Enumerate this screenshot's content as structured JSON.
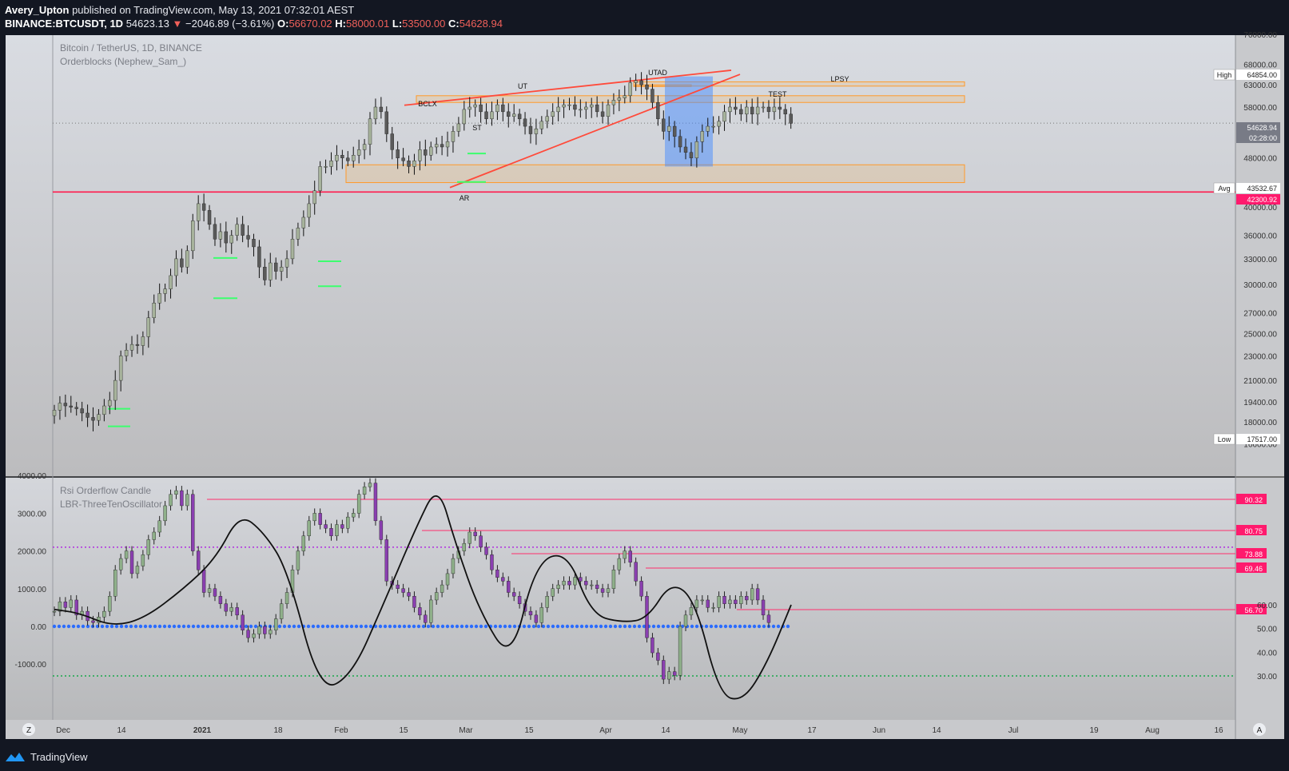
{
  "header": {
    "author": "Avery_Upton",
    "published_text": "published on TradingView.com, May 13, 2021 07:32:01 AEST",
    "symbol": "BINANCE:BTCUSDT, 1D",
    "last": "54623.13",
    "arrow": "▼",
    "change": "−2046.89 (−3.61%)",
    "o_label": "O:",
    "o_value": "56670.02",
    "h_label": "H:",
    "h_value": "58000.01",
    "l_label": "L:",
    "l_value": "53500.00",
    "c_label": "C:",
    "c_value": "54628.94"
  },
  "footer": {
    "brand": "TradingView",
    "logo_icon": "tradingview-logo-icon"
  },
  "colors": {
    "up": "#a7b39c",
    "down": "#5a5a5a",
    "wick": "#111111",
    "redline": "#ff1a4d",
    "orange": "#ff9a2a",
    "green": "#3cff6e",
    "purple": "#b12fe0",
    "blue": "#2b6cff",
    "green_dot": "#1aa84a"
  },
  "chart_data": [
    {
      "type": "candlestick",
      "title": "Bitcoin / TetherUS, 1D, BINANCE",
      "indicator": "Orderblocks (Nephew_Sam_)",
      "scale": "log",
      "y_ticks": [
        "76000.00",
        "68000.00",
        "63000.00",
        "58000.00",
        "53000.00",
        "48000.00",
        "43000.00",
        "40000.00",
        "36000.00",
        "33000.00",
        "30000.00",
        "27000.00",
        "25000.00",
        "23000.00",
        "21000.00",
        "19400.00",
        "18000.00",
        "16600.00"
      ],
      "x_ticks": [
        "Dec",
        "14",
        "2021",
        "18",
        "Feb",
        "15",
        "Mar",
        "15",
        "Apr",
        "14",
        "May",
        "17",
        "Jun",
        "14",
        "Jul",
        "19",
        "Aug",
        "16"
      ],
      "ohlc_close_approx": [
        18800,
        19300,
        19100,
        19000,
        18900,
        18600,
        18300,
        18100,
        18500,
        19100,
        19500,
        21000,
        23000,
        23500,
        24000,
        23900,
        24700,
        26500,
        28000,
        29000,
        29500,
        31000,
        33000,
        32000,
        34000,
        38000,
        40500,
        39500,
        37500,
        35500,
        36500,
        35000,
        36000,
        37500,
        36000,
        35500,
        34500,
        32000,
        30500,
        32500,
        31500,
        32000,
        33000,
        35500,
        37000,
        38500,
        40500,
        42500,
        46500,
        46500,
        47500,
        48500,
        48000,
        47500,
        48500,
        49500,
        50500,
        55500,
        58000,
        57000,
        52500,
        49500,
        48000,
        47500,
        46500,
        47500,
        49500,
        48500,
        50000,
        50500,
        50000,
        51000,
        53000,
        54500,
        57500,
        58000,
        58500,
        57000,
        55500,
        57000,
        58500,
        57000,
        56000,
        56500,
        55500,
        54000,
        52500,
        53500,
        55000,
        56000,
        57000,
        58000,
        58500,
        58500,
        57500,
        57500,
        58000,
        58500,
        57000,
        56000,
        58500,
        59500,
        60000,
        60500,
        63500,
        64000,
        63000,
        62000,
        59000,
        55500,
        53000,
        54000,
        52000,
        50000,
        49000,
        48000,
        51000,
        53000,
        54000,
        54000,
        55000,
        57000,
        58000,
        57500,
        56500,
        58000,
        56500,
        58000,
        58000,
        57000,
        58000,
        57500,
        56500,
        54600
      ],
      "levels": [
        {
          "label": "High",
          "value": "64854.00"
        },
        {
          "label": "",
          "value": "54628.94",
          "sub": "02:28:00"
        },
        {
          "label": "Avg",
          "value": "43532.67"
        },
        {
          "label": "",
          "value": "42300.92"
        },
        {
          "label": "Low",
          "value": "17517.00"
        }
      ],
      "annotations": [
        "UTAD",
        "UT",
        "BCLX",
        "ST",
        "AR",
        "TEST",
        "LPSY"
      ]
    },
    {
      "type": "candlestick",
      "title": "Rsi Orderflow Candle",
      "indicator": "LBR-ThreeTenOscillator",
      "left_ticks": [
        "4000.00",
        "3000.00",
        "2000.00",
        "1000.00",
        "0.00",
        "-1000.00"
      ],
      "right_ticks": [
        "60.00",
        "50.00",
        "40.00",
        "30.00"
      ],
      "levels": [
        "90.32",
        "80.75",
        "73.88",
        "69.46",
        "56.70"
      ]
    }
  ],
  "axis_buttons": {
    "left": "Z",
    "right": "A"
  }
}
